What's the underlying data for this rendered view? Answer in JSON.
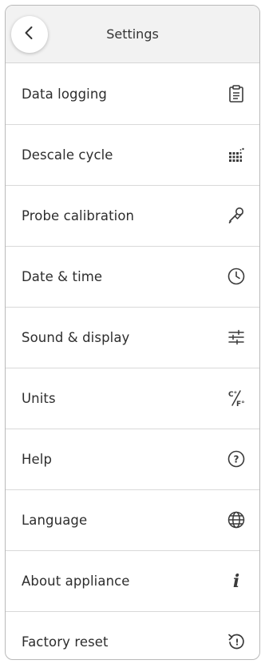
{
  "header": {
    "title": "Settings",
    "back_icon": "chevron-left-icon"
  },
  "menu": {
    "items": [
      {
        "label": "Data logging",
        "icon": "clipboard-icon"
      },
      {
        "label": "Descale cycle",
        "icon": "descale-dots-icon"
      },
      {
        "label": "Probe calibration",
        "icon": "probe-icon"
      },
      {
        "label": "Date & time",
        "icon": "clock-icon"
      },
      {
        "label": "Sound & display",
        "icon": "sliders-icon"
      },
      {
        "label": "Units",
        "icon": "temperature-units-icon",
        "icon_text": [
          "C°",
          "F°"
        ]
      },
      {
        "label": "Help",
        "icon": "help-icon",
        "icon_text": [
          "?"
        ]
      },
      {
        "label": "Language",
        "icon": "globe-icon"
      },
      {
        "label": "About appliance",
        "icon": "info-icon",
        "icon_text": [
          "i"
        ]
      },
      {
        "label": "Factory reset",
        "icon": "reset-icon",
        "icon_text": [
          "!"
        ]
      }
    ]
  },
  "colors": {
    "header_bg": "#f2f2f2",
    "text": "#2d2d2d",
    "icon": "#3a3a3a",
    "divider": "#d9d9d9"
  }
}
